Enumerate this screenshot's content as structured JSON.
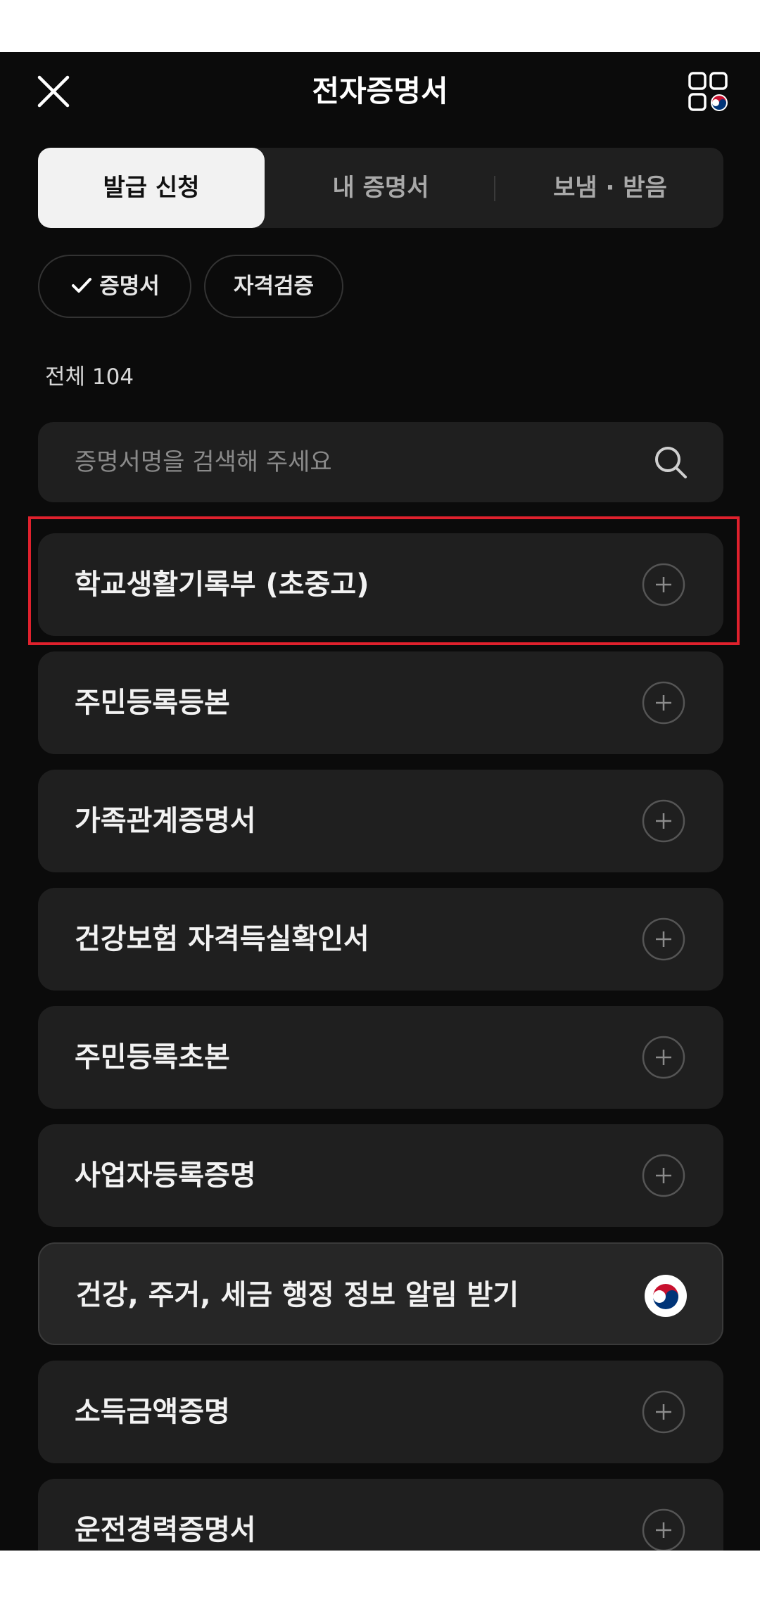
{
  "header": {
    "title": "전자증명서",
    "close_icon": "close-icon",
    "apps_icon": "apps-grid-icon"
  },
  "tabs": [
    {
      "label": "발급 신청",
      "active": true
    },
    {
      "label": "내 증명서",
      "active": false
    },
    {
      "label": "보냄 · 받음",
      "active": false
    }
  ],
  "filters": [
    {
      "label": "증명서",
      "selected": true
    },
    {
      "label": "자격검증",
      "selected": false
    }
  ],
  "total_label": "전체 104",
  "search": {
    "placeholder": "증명서명을 검색해 주세요"
  },
  "items": [
    {
      "label": "학교생활기록부 (초중고)",
      "icon": "plus-icon"
    },
    {
      "label": "주민등록등본",
      "icon": "plus-icon"
    },
    {
      "label": "가족관계증명서",
      "icon": "plus-icon"
    },
    {
      "label": "건강보험 자격득실확인서",
      "icon": "plus-icon"
    },
    {
      "label": "주민등록초본",
      "icon": "plus-icon"
    },
    {
      "label": "사업자등록증명",
      "icon": "plus-icon"
    },
    {
      "label": "건강, 주거, 세금 행정 정보 알림 받기",
      "icon": "korea-emblem-icon"
    },
    {
      "label": "소득금액증명",
      "icon": "plus-icon"
    },
    {
      "label": "운전경력증명서",
      "icon": "plus-icon"
    }
  ],
  "colors": {
    "background": "#0b0b0b",
    "card": "#1f1f1f",
    "highlight": "#e0212d",
    "emblem_red": "#c8102e",
    "emblem_blue": "#003478"
  }
}
